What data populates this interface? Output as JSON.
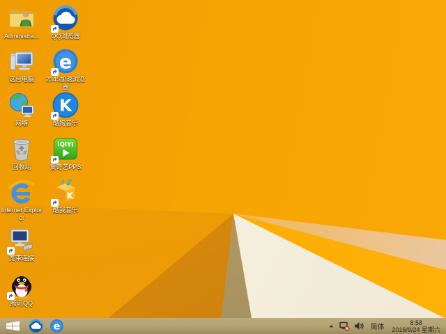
{
  "wallpaper": {
    "base_color": "#f6a404",
    "left_shade_color": "#ec9a06",
    "dark_triangle_color": "#c97f10",
    "olive_wedge_color": "#a39164",
    "white_triangle_color": "#f7f1e1",
    "bright_band_color": "#ffae05",
    "peach_corner_color": "#ecc69c"
  },
  "desktop": {
    "icons": [
      {
        "label": "Administra...",
        "icon": "user-folder-icon",
        "shortcut": false
      },
      {
        "label": "QQ浏览器",
        "icon": "qq-browser-icon",
        "shortcut": true
      },
      {
        "label": "这台电脑",
        "icon": "this-pc-icon",
        "shortcut": false
      },
      {
        "label": "2345加速浏览器",
        "icon": "2345-browser-icon",
        "shortcut": true
      },
      {
        "label": "网络",
        "icon": "network-icon",
        "shortcut": false
      },
      {
        "label": "酷狗音乐",
        "icon": "kugou-music-icon",
        "shortcut": true
      },
      {
        "label": "回收站",
        "icon": "recycle-bin-icon",
        "shortcut": false
      },
      {
        "label": "爱奇艺PPS",
        "icon": "iqiyi-pps-icon",
        "shortcut": true
      },
      {
        "label": "Internet Explorer",
        "icon": "internet-explorer-icon",
        "shortcut": false
      },
      {
        "label": "酷我音乐",
        "icon": "kuwo-music-icon",
        "shortcut": true
      },
      {
        "label": "宽带连接",
        "icon": "broadband-connection-icon",
        "shortcut": true
      },
      {
        "label": "腾讯QQ",
        "icon": "tencent-qq-icon",
        "shortcut": true
      }
    ],
    "glyphs": {
      "kugou_letter": "K",
      "kuwo_letter": "K",
      "iqiyi_text": "iQIYI",
      "browser_2345_letter": "e"
    }
  },
  "taskbar": {
    "buttons": [
      "start-button",
      "qq-browser",
      "2345-browser"
    ],
    "tray": {
      "ime_label": "简体",
      "time": "8:58",
      "date": "2016/9/24 星期六"
    }
  }
}
